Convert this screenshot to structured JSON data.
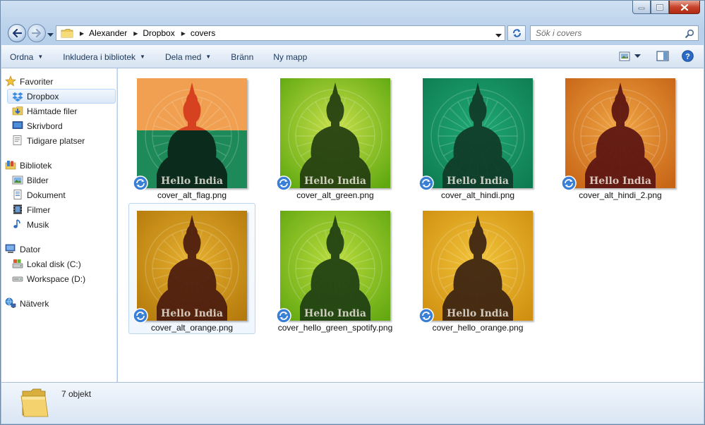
{
  "window": {
    "title": ""
  },
  "address": {
    "crumbs": [
      "Alexander",
      "Dropbox",
      "covers"
    ],
    "search_placeholder": "Sök i covers"
  },
  "toolbar": {
    "items": [
      {
        "label": "Ordna",
        "dropdown": true
      },
      {
        "label": "Inkludera i bibliotek",
        "dropdown": true
      },
      {
        "label": "Dela med",
        "dropdown": true
      },
      {
        "label": "Bränn",
        "dropdown": false
      },
      {
        "label": "Ny mapp",
        "dropdown": false
      }
    ]
  },
  "sidebar": {
    "favorites": {
      "label": "Favoriter",
      "items": [
        {
          "label": "Dropbox",
          "icon": "dropbox-icon",
          "selected": true
        },
        {
          "label": "Hämtade filer",
          "icon": "downloads-icon"
        },
        {
          "label": "Skrivbord",
          "icon": "desktop-icon"
        },
        {
          "label": "Tidigare platser",
          "icon": "recent-places-icon"
        }
      ]
    },
    "libraries": {
      "label": "Bibliotek",
      "items": [
        {
          "label": "Bilder",
          "icon": "pictures-icon"
        },
        {
          "label": "Dokument",
          "icon": "documents-icon"
        },
        {
          "label": "Filmer",
          "icon": "videos-icon"
        },
        {
          "label": "Musik",
          "icon": "music-icon"
        }
      ]
    },
    "computer": {
      "label": "Dator",
      "items": [
        {
          "label": "Lokal disk (C:)",
          "icon": "local-disk-icon"
        },
        {
          "label": "Workspace (D:)",
          "icon": "drive-icon"
        }
      ]
    },
    "network": {
      "label": "Nätverk"
    }
  },
  "files": [
    {
      "name": "cover_alt_flag.png",
      "caption": "Hello India",
      "style": "flag",
      "colors": [
        "#f0a050",
        "#d6411f",
        "#1e8a5a"
      ]
    },
    {
      "name": "cover_alt_green.png",
      "caption": "Hello India",
      "style": "radial",
      "colors": [
        "#c8e04a",
        "#5fa810",
        "#233d10"
      ]
    },
    {
      "name": "cover_alt_hindi.png",
      "caption": "Hello India",
      "style": "radial",
      "colors": [
        "#1fa874",
        "#0e7c52",
        "#0f3a28"
      ]
    },
    {
      "name": "cover_alt_hindi_2.png",
      "caption": "Hello India",
      "style": "radial",
      "colors": [
        "#f0a544",
        "#c76416",
        "#5a1410"
      ]
    },
    {
      "name": "cover_alt_orange.png",
      "caption": "Hello India",
      "style": "radial",
      "colors": [
        "#e6b02e",
        "#b57a0c",
        "#4a1a0e"
      ]
    },
    {
      "name": "cover_hello_green_spotify.png",
      "caption": "Hello India",
      "style": "radial",
      "colors": [
        "#b9dc3c",
        "#63a812",
        "#1e3e12"
      ]
    },
    {
      "name": "cover_hello_orange.png",
      "caption": "Hello India",
      "style": "radial",
      "colors": [
        "#f2c43a",
        "#d08f10",
        "#3a2210"
      ]
    }
  ],
  "status": {
    "count_text": "7 objekt"
  }
}
